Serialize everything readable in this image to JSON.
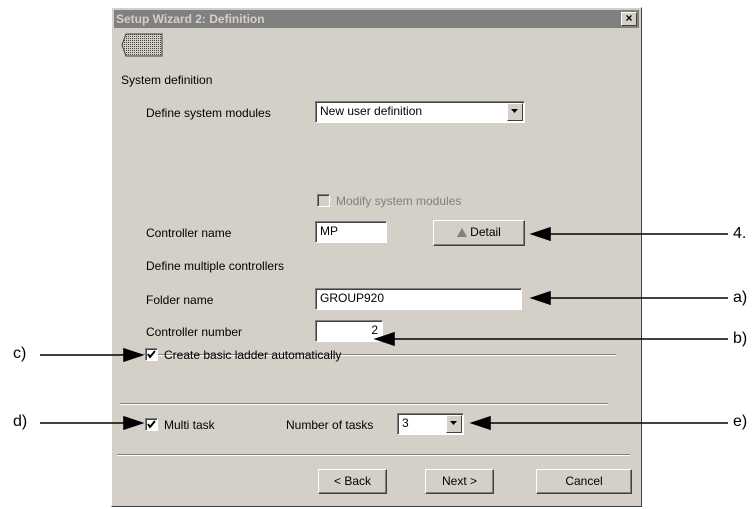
{
  "window": {
    "title": "Setup Wizard  2: Definition",
    "close_label": "×"
  },
  "system_definition": {
    "heading": "System definition",
    "modules_label": "Define system modules",
    "modules_value": "New user definition",
    "modify_label": "Modify system modules"
  },
  "controller": {
    "name_label": "Controller name",
    "name_value": "MP",
    "detail_label": "Detail"
  },
  "multiple": {
    "heading": "Define multiple controllers",
    "folder_label": "Folder name",
    "folder_value": "GROUP920",
    "number_label": "Controller number",
    "number_value": "2"
  },
  "ladder": {
    "label": "Create basic ladder automatically",
    "checked": true
  },
  "multitask": {
    "label": "Multi task",
    "checked": true,
    "tasks_label": "Number of tasks",
    "tasks_value": "3"
  },
  "buttons": {
    "back": "< Back",
    "next": "Next >",
    "cancel": "Cancel"
  },
  "annotations": {
    "detail": "4.",
    "folder": "a)",
    "number": "b)",
    "ladder": "c)",
    "multitask": "d)",
    "tasks": "e)"
  }
}
